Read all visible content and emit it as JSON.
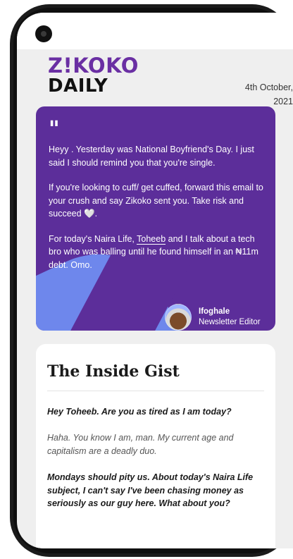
{
  "newsletter": {
    "logo_top": "Z!KOKO",
    "logo_bottom": "DAILY",
    "date_line1": "4th October,",
    "date_line2": "2021"
  },
  "intro": {
    "quote_mark": "\"",
    "para1": "Heyy . Yesterday was National Boyfriend's Day. I just said I should remind you that you're single.",
    "para2_before": "If you're looking to cuff/ get cuffed, forward this email to your crush and say Zikoko sent you. Take risk and succeed ",
    "para2_heart": "🤍",
    "para2_after": ".",
    "para3_before": "For today's Naira Life, ",
    "para3_link": "Toheeb",
    "para3_after": " and I talk about a tech bro who was balling until he found himself in an ₦11m debt. Omo.",
    "editor_name": "Ifoghale",
    "editor_role": "Newsletter Editor"
  },
  "gist": {
    "title": "The Inside Gist",
    "q1": "Hey Toheeb. Are you as tired as I am today?",
    "a1": "Haha. You know I am, man. My current age and capitalism are a deadly duo.",
    "q2": "Mondays should pity us. About today's Naira Life subject, I can't say I've been chasing money as seriously as our guy here. What about you?"
  },
  "colors": {
    "brand_purple": "#5c2e9a",
    "accent_blue": "#6f8cf0",
    "logo_purple": "#6a2fa3"
  }
}
